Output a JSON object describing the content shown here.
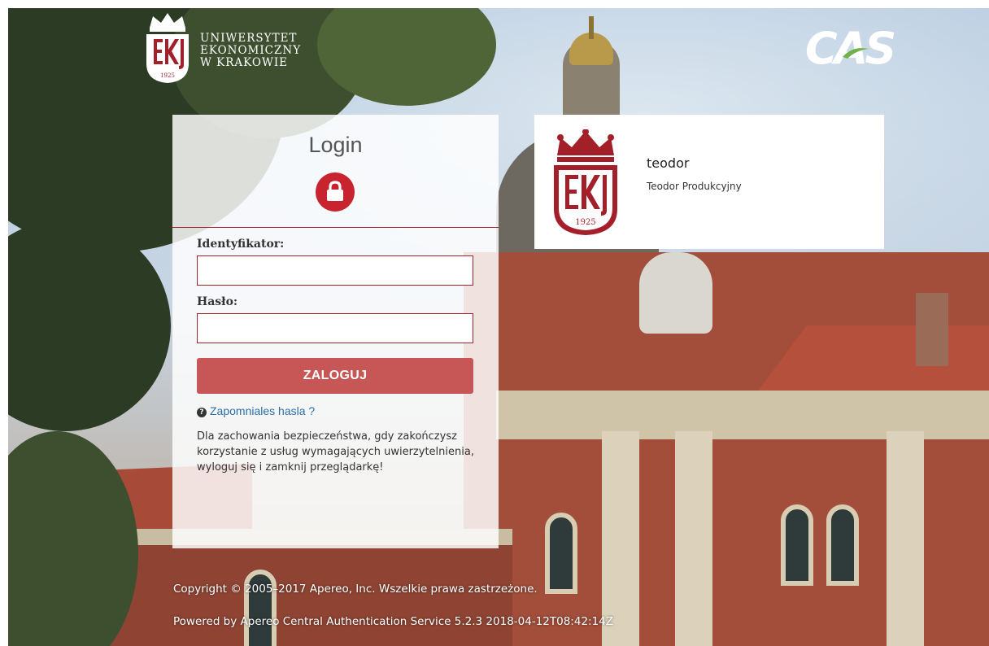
{
  "header": {
    "university_name_lines": [
      "UNIWERSYTET",
      "EKONOMICZNY",
      "W KRAKOWIE"
    ],
    "logo_year": "1925",
    "cas_logo_text": "CAS"
  },
  "login": {
    "title": "Login",
    "username_label": "Identyfikator:",
    "username_value": "",
    "password_label": "Hasło:",
    "password_value": "",
    "submit_label": "ZALOGUJ",
    "forgot_password_link": "Zapomniales hasla ?",
    "security_note": "Dla zachowania bezpieczeństwa, gdy zakończysz korzystanie z usług wymagających uwierzytelnienia, wyloguj się i zamknij przeglądarkę!"
  },
  "service": {
    "name": "teodor",
    "description": "Teodor Produkcyjny",
    "logo_year": "1925"
  },
  "footer": {
    "copyright": "Copyright © 2005–2017 Apereo, Inc. Wszelkie prawa zastrzeżone.",
    "powered_by": "Powered by Apereo Central Authentication Service 5.2.3 2018-04-12T08:42:14Z"
  },
  "colors": {
    "brand_red": "#a31f2a",
    "button_red": "#c75656",
    "lock_red": "#c8242f",
    "link_blue": "#2a6fa8"
  },
  "icons": {
    "lock": "lock-icon",
    "help": "question-circle-icon",
    "crown": "crown-icon"
  }
}
